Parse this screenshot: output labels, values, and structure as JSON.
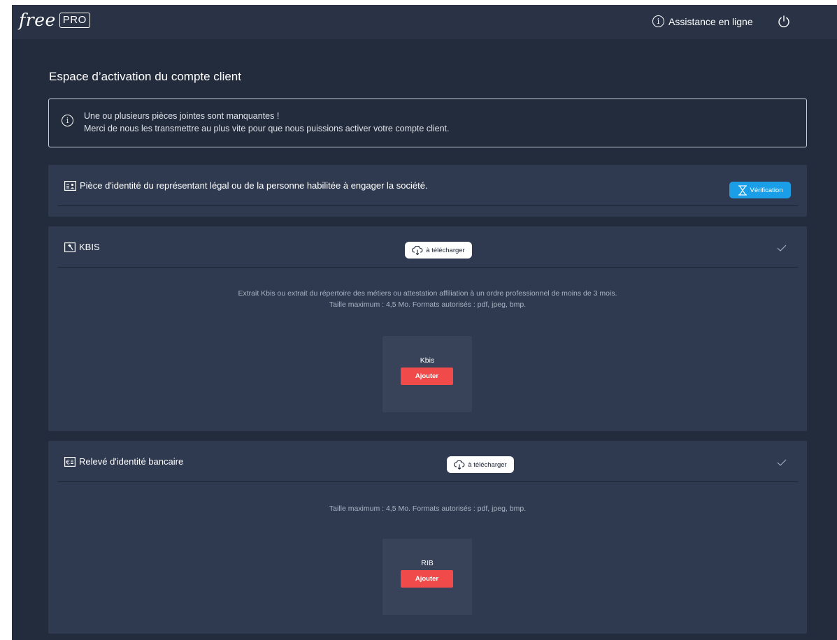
{
  "header": {
    "logo_text": "free",
    "logo_badge": "PRO",
    "assist_label": "Assistance en ligne"
  },
  "page": {
    "title": "Espace d’activation du compte client"
  },
  "alert": {
    "line1": "Une ou plusieurs pièces jointes sont manquantes !",
    "line2": "Merci de nous les transmettre au plus vite pour que nous puissions activer votre compte client."
  },
  "sections": [
    {
      "title": "Pièce d'identité du représentant légal ou de la personne habilitée à engager la société.",
      "status": "Vérification"
    },
    {
      "title": "KBIS",
      "download_label": "à télécharger",
      "desc_line1": "Extrait Kbis ou extrait du répertoire des métiers ou attestation affiliation à un ordre professionnel de moins de 3 mois.",
      "desc_line2": "Taille maximum : 4,5 Mo. Formats autorisés : pdf, jpeg, bmp.",
      "upload_label": "Kbis",
      "upload_button": "Ajouter"
    },
    {
      "title": "Relevé d'identité bancaire",
      "download_label": "à télécharger",
      "desc_line1": "Taille maximum : 4,5 Mo. Formats autorisés : pdf, jpeg, bmp.",
      "upload_label": "RIB",
      "upload_button": "Ajouter"
    }
  ],
  "icons": {
    "info": "info-icon",
    "power": "power-icon",
    "id_card": "id-card-icon",
    "hammer": "hammer-doc-icon",
    "euro_doc": "euro-doc-icon",
    "hourglass": "hourglass-icon",
    "cloud_download": "cloud-download-icon",
    "check": "check-icon"
  },
  "colors": {
    "background": "#232c3c",
    "topbar": "#293345",
    "section": "#2f3a51",
    "verification_badge": "#1a9ee8",
    "add_button": "#f04a4a"
  }
}
